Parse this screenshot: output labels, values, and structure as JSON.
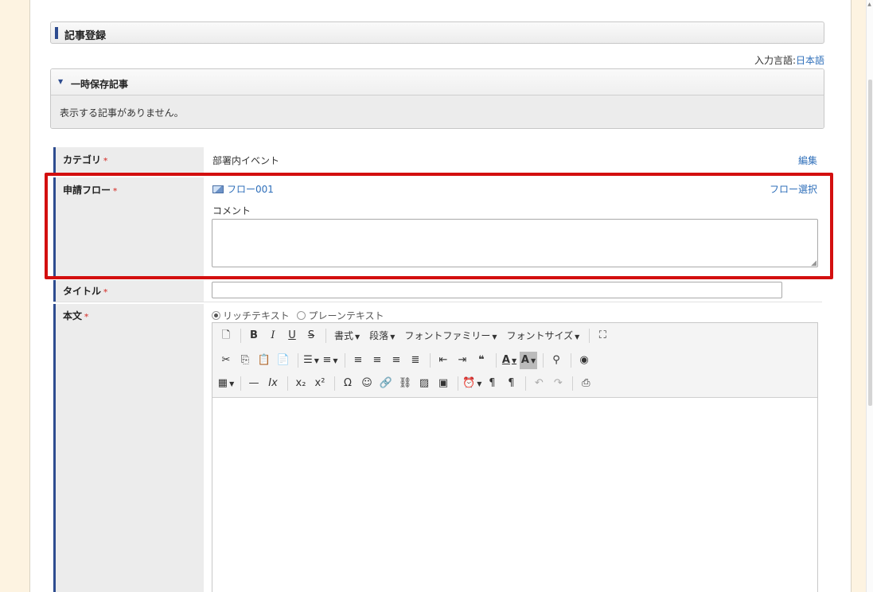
{
  "header": {
    "title": "記事登録"
  },
  "language": {
    "label": "入力言語:",
    "value": "日本語"
  },
  "temp_saved": {
    "title": "一時保存記事",
    "message": "表示する記事がありません。"
  },
  "form": {
    "required_mark": "*",
    "category": {
      "label": "カテゴリ",
      "value": "部署内イベント",
      "edit_link": "編集"
    },
    "flow": {
      "label": "申請フロー",
      "value": "フロー001",
      "select_link": "フロー選択",
      "comment_label": "コメント",
      "comment_value": ""
    },
    "title": {
      "label": "タイトル",
      "value": ""
    },
    "body": {
      "label": "本文",
      "mode_rich": "リッチテキスト",
      "mode_plain": "プレーンテキスト",
      "selected_mode": "rich",
      "toolbar": {
        "format": "書式",
        "paragraph": "段落",
        "font_family": "フォントファミリー",
        "font_size": "フォントサイズ"
      }
    }
  },
  "colors": {
    "accent": "#2e4c8f",
    "link": "#2f6fba",
    "highlight": "#d30f0f",
    "required": "#d9534f",
    "background": "#fdf3e1"
  }
}
